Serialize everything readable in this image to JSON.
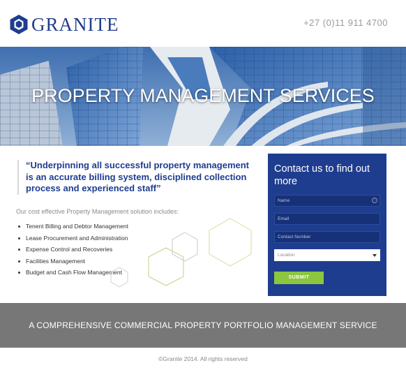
{
  "header": {
    "logo_text": "GRANITE",
    "phone": "+27 (0)11 911 4700"
  },
  "hero": {
    "title": "PROPERTY MANAGEMENT SERVICES"
  },
  "quote": {
    "text": "“Underpinning all successful property management is an accurate billing system, disciplined collection process and experienced staff”"
  },
  "services": {
    "intro": "Our cost effective Property Management solution includes:",
    "items": [
      "Tenent Billing and Debtor Management",
      "Lease Procurement and Administration",
      "Expense Control and Recoveries",
      "Facilities Management",
      "Budget and Cash Flow Management"
    ]
  },
  "contact": {
    "title": "Contact us to find out more",
    "name_placeholder": "Name",
    "email_placeholder": "Email",
    "number_placeholder": "Contact Number",
    "location_value": "Location",
    "info_icon": "i",
    "submit_label": "SUBMIT"
  },
  "banner": {
    "text": "A COMPREHENSIVE COMMERCIAL PROPERTY PORTFOLIO MANAGEMENT SERVICE"
  },
  "footer": {
    "copyright": "©Granite 2014. All rights reserved"
  },
  "colors": {
    "brand_blue": "#1f3d8f",
    "submit_green": "#8cc63f",
    "banner_grey": "#777777"
  }
}
